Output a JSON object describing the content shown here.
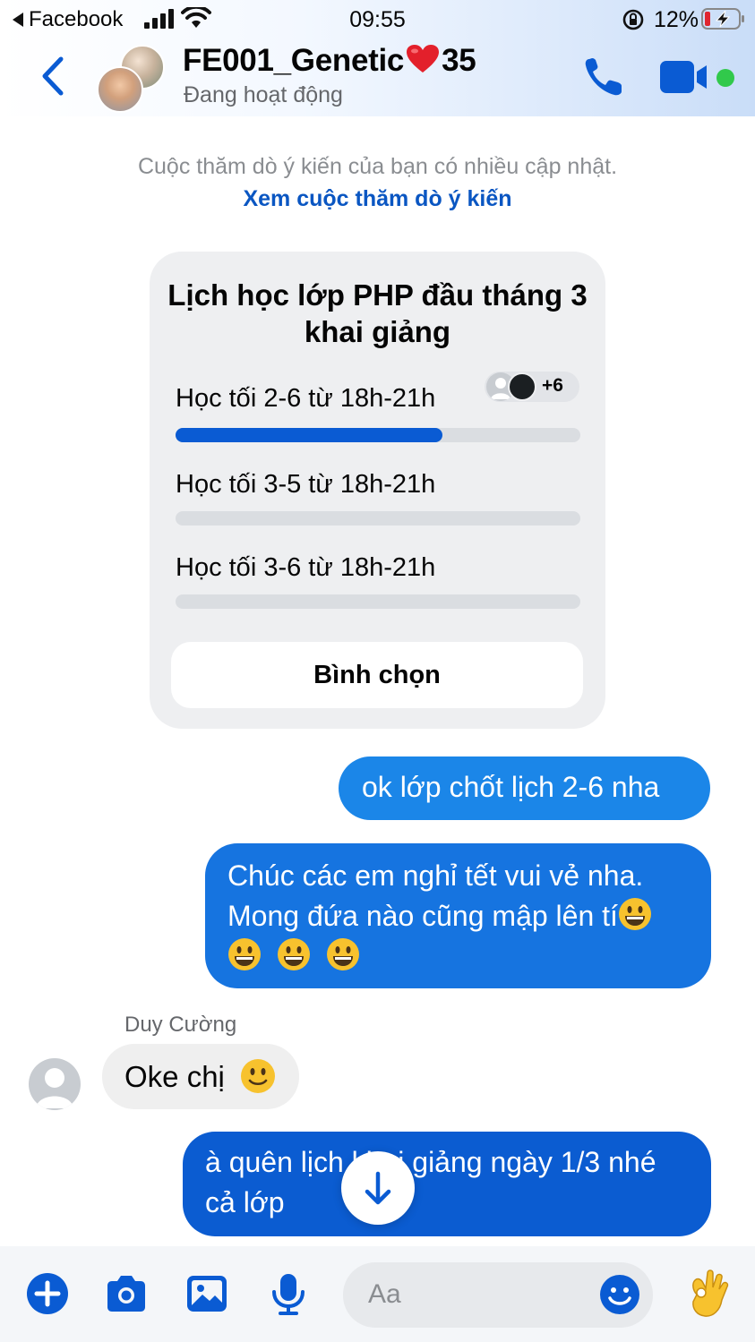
{
  "status_bar": {
    "back_app": "Facebook",
    "time": "09:55",
    "battery_percent": "12%"
  },
  "header": {
    "title_part1": "FE001_Genetic",
    "title_part2": "35",
    "subtitle": "Đang hoạt động"
  },
  "notice": {
    "text": "Cuộc thăm dò ý kiến của bạn có nhiều cập nhật.",
    "link": "Xem cuộc thăm dò ý kiến"
  },
  "poll": {
    "question": "Lịch học lớp PHP đầu tháng 3 khai giảng",
    "options": [
      {
        "label": "Học tối 2-6 từ 18h-21h",
        "vote_fraction": 0.66,
        "voters_more": "+6"
      },
      {
        "label": "Học tối 3-5 từ 18h-21h",
        "vote_fraction": 0
      },
      {
        "label": "Học tối 3-6 từ 18h-21h",
        "vote_fraction": 0
      }
    ],
    "vote_button": "Bình chọn"
  },
  "messages": [
    {
      "from": "me",
      "text": "ok lớp chốt lịch 2-6 nha"
    },
    {
      "from": "me",
      "line1": "Chúc các em nghỉ tết vui vẻ nha.",
      "line2": "Mong đứa nào cũng mập lên tí"
    },
    {
      "from": "Duy Cường",
      "sender": "Duy Cường",
      "text": "Oke chị"
    },
    {
      "from": "me",
      "line1": "à quên lịch khai giảng ngày 1/3 nhé",
      "line2": "cả lớp"
    }
  ],
  "composer": {
    "placeholder": "Aa"
  },
  "colors": {
    "accent": "#0a5bd3",
    "bubble_top": "#1b86e8",
    "bubble_bottom": "#0b5cd1",
    "online": "#31c94b"
  }
}
